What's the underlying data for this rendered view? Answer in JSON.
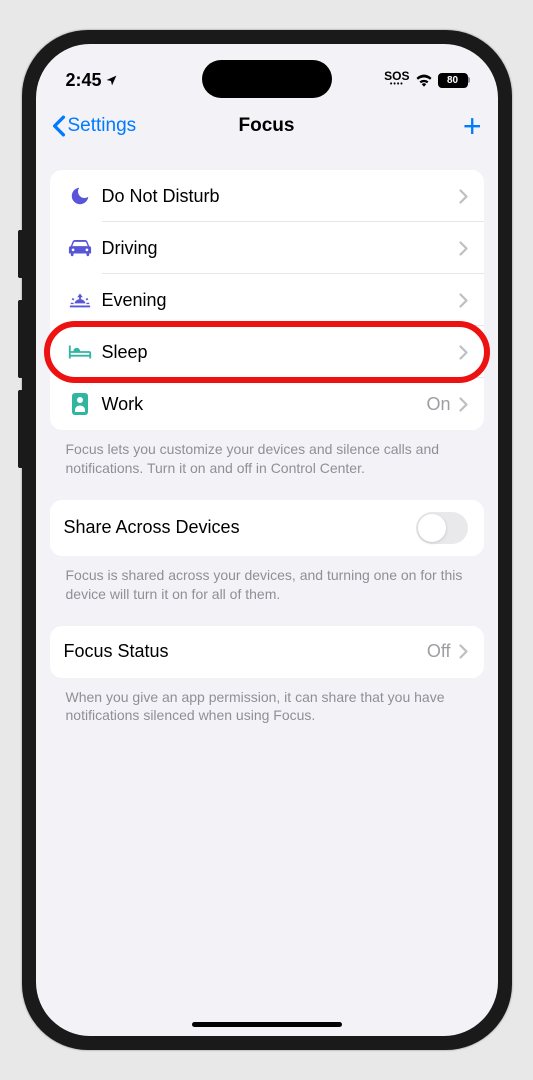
{
  "status": {
    "time": "2:45",
    "sos": "SOS",
    "battery": "80"
  },
  "nav": {
    "back": "Settings",
    "title": "Focus"
  },
  "modes": [
    {
      "label": "Do Not Disturb",
      "icon": "moon",
      "color": "#5856d6",
      "value": ""
    },
    {
      "label": "Driving",
      "icon": "car",
      "color": "#5856d6",
      "value": ""
    },
    {
      "label": "Evening",
      "icon": "sunset",
      "color": "#5856d6",
      "value": ""
    },
    {
      "label": "Sleep",
      "icon": "bed",
      "color": "#30b5a0",
      "value": ""
    },
    {
      "label": "Work",
      "icon": "badge",
      "color": "#30b5a0",
      "value": "On"
    }
  ],
  "footers": {
    "modes": "Focus lets you customize your devices and silence calls and notifications. Turn it on and off in Control Center.",
    "share": "Focus is shared across your devices, and turning one on for this device will turn it on for all of them.",
    "status": "When you give an app permission, it can share that you have notifications silenced when using Focus."
  },
  "share": {
    "label": "Share Across Devices"
  },
  "statusRow": {
    "label": "Focus Status",
    "value": "Off"
  },
  "highlighted_index": 3
}
